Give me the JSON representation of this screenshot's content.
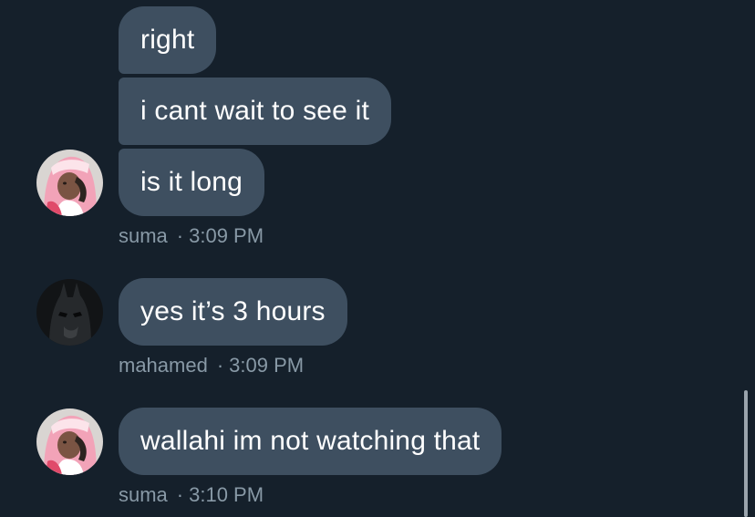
{
  "conversation": {
    "messages": [
      {
        "text": "right"
      },
      {
        "text": "i cant wait to see it"
      },
      {
        "text": "is it long"
      },
      {
        "text": "yes it’s 3 hours"
      },
      {
        "text": "wallahi im not watching that"
      }
    ],
    "groups": [
      {
        "sender": "suma",
        "time": "3:09 PM",
        "avatar": "pink-hijab-avatar"
      },
      {
        "sender": "mahamed",
        "time": "3:09 PM",
        "avatar": "batman-avatar"
      },
      {
        "sender": "suma",
        "time": "3:10 PM",
        "avatar": "pink-hijab-avatar"
      }
    ],
    "separator": "·"
  },
  "colors": {
    "background": "#15202b",
    "bubble": "#3e4f60",
    "text": "#ffffff",
    "meta": "#8899a6",
    "scrollbar": "#9aa4ad"
  }
}
